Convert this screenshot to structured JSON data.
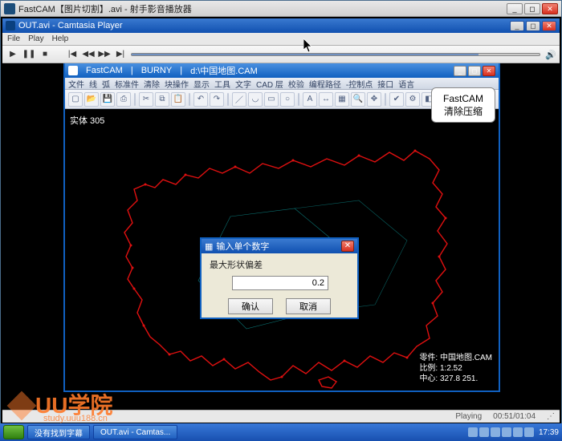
{
  "outer_window": {
    "title": "FastCAM【图片切割】.avi - 射手影音播放器"
  },
  "camtasia": {
    "title": "OUT.avi - Camtasia Player",
    "menu": [
      "File",
      "Play",
      "Help"
    ],
    "status_playing": "Playing",
    "time": "00:51/01:04"
  },
  "fastcam": {
    "title_parts": [
      "FastCAM",
      "BURNY",
      "d:\\中国地图.CAM"
    ],
    "menu": [
      "文件",
      "线",
      "弧",
      "标准件",
      "清除",
      "块操作",
      "显示",
      "工具",
      "文字",
      "CAD 层",
      "校验",
      "编程路径",
      "-控制点",
      "接口",
      "语言"
    ],
    "entity_label": "实体  305",
    "info": {
      "l1": "零件:  中国地图.CAM",
      "l2": "比例:  1:2.52",
      "l3": "中心:  327.8 251."
    },
    "callout": "FastCAM\n清除压缩"
  },
  "dialog": {
    "title": "输入单个数字",
    "label": "最大形状偏差",
    "value": "0.2",
    "ok": "确认",
    "cancel": "取消"
  },
  "watermark": {
    "main": "UU学院",
    "sub": "study.uuu188.cn"
  },
  "taskbar": {
    "items": [
      "没有找到字幕",
      "OUT.avi - Camtas..."
    ],
    "clock": "17:39"
  }
}
